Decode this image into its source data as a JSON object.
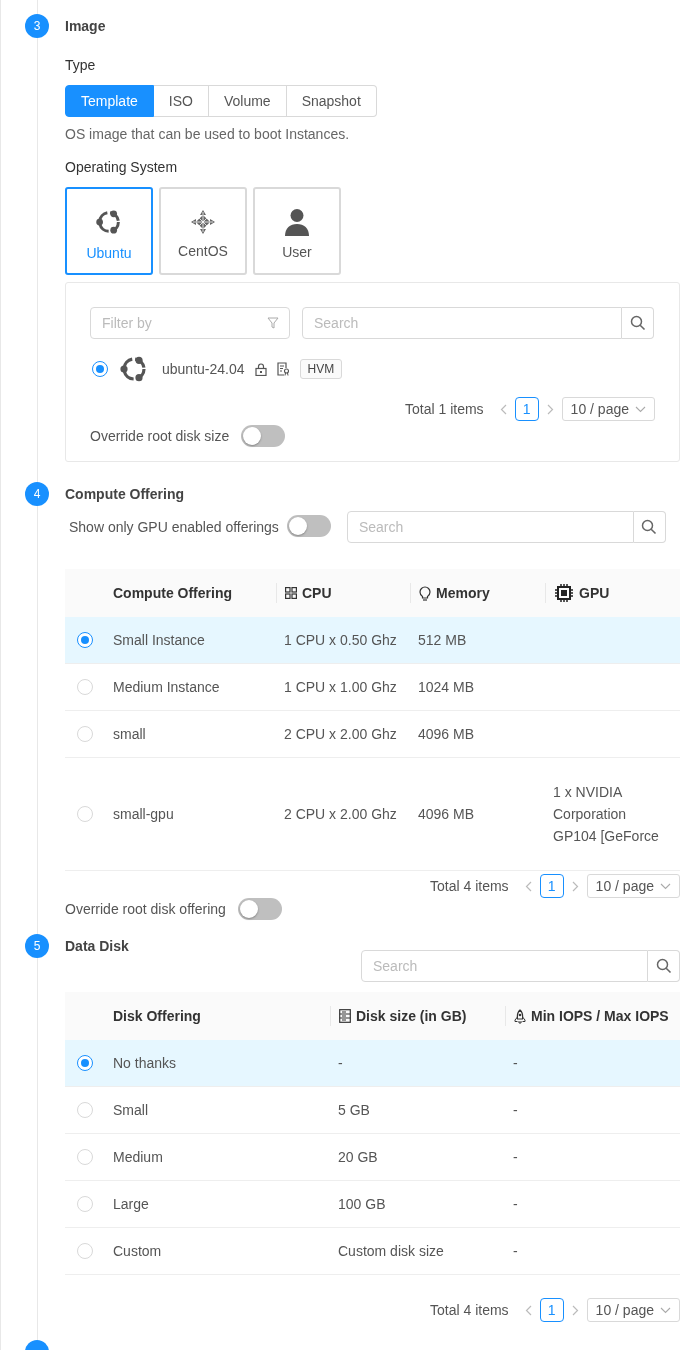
{
  "image_step": {
    "number": "3",
    "title": "Image",
    "type_label": "Type",
    "type_tabs": [
      {
        "label": "Template",
        "selected": true
      },
      {
        "label": "ISO",
        "selected": false
      },
      {
        "label": "Volume",
        "selected": false
      },
      {
        "label": "Snapshot",
        "selected": false
      }
    ],
    "hint": "OS image that can be used to boot Instances.",
    "os_label": "Operating System",
    "os_options": [
      {
        "label": "Ubuntu",
        "kind": "ubuntu",
        "selected": true
      },
      {
        "label": "CentOS",
        "kind": "centos",
        "selected": false
      },
      {
        "label": "User",
        "kind": "user",
        "selected": false
      }
    ],
    "filter": {
      "placeholder": "Filter by"
    },
    "search": {
      "placeholder": "Search"
    },
    "templates": [
      {
        "name": "ubuntu-24.04",
        "selected": true,
        "tag": "HVM"
      }
    ],
    "pagination": {
      "total": "Total 1 items",
      "page": "1",
      "page_size": "10 / page"
    },
    "override": {
      "label": "Override root disk size",
      "on": false
    }
  },
  "compute_step": {
    "number": "4",
    "title": "Compute Offering",
    "gpu_toggle": {
      "label": "Show only GPU enabled offerings",
      "on": false
    },
    "search": {
      "placeholder": "Search"
    },
    "columns": [
      {
        "label": "Compute Offering"
      },
      {
        "label": "CPU"
      },
      {
        "label": "Memory"
      },
      {
        "label": "GPU"
      }
    ],
    "rows": [
      {
        "selected": true,
        "cells": [
          "Small Instance",
          "1 CPU x 0.50 Ghz",
          "512 MB",
          ""
        ]
      },
      {
        "selected": false,
        "cells": [
          "Medium Instance",
          "1 CPU x 1.00 Ghz",
          "1024 MB",
          ""
        ]
      },
      {
        "selected": false,
        "cells": [
          "small",
          "2 CPU x 2.00 Ghz",
          "4096 MB",
          ""
        ]
      },
      {
        "selected": false,
        "cells": [
          "small-gpu",
          "2 CPU x 2.00 Ghz",
          "4096 MB",
          "1 x NVIDIA Corporation GP104 [GeForce"
        ]
      }
    ],
    "pagination": {
      "total": "Total 4 items",
      "page": "1",
      "page_size": "10 / page"
    },
    "override": {
      "label": "Override root disk offering",
      "on": false
    }
  },
  "data_disk_step": {
    "number": "5",
    "title": "Data Disk",
    "search": {
      "placeholder": "Search"
    },
    "columns": [
      {
        "label": "Disk Offering"
      },
      {
        "label": "Disk size (in GB)"
      },
      {
        "label": "Min IOPS / Max IOPS"
      }
    ],
    "rows": [
      {
        "selected": true,
        "cells": [
          "No thanks",
          "-",
          "-"
        ]
      },
      {
        "selected": false,
        "cells": [
          "Small",
          "5 GB",
          "-"
        ]
      },
      {
        "selected": false,
        "cells": [
          "Medium",
          "20 GB",
          "-"
        ]
      },
      {
        "selected": false,
        "cells": [
          "Large",
          "100 GB",
          "-"
        ]
      },
      {
        "selected": false,
        "cells": [
          "Custom",
          "Custom disk size",
          "-"
        ]
      }
    ],
    "pagination": {
      "total": "Total 4 items",
      "page": "1",
      "page_size": "10 / page"
    }
  }
}
